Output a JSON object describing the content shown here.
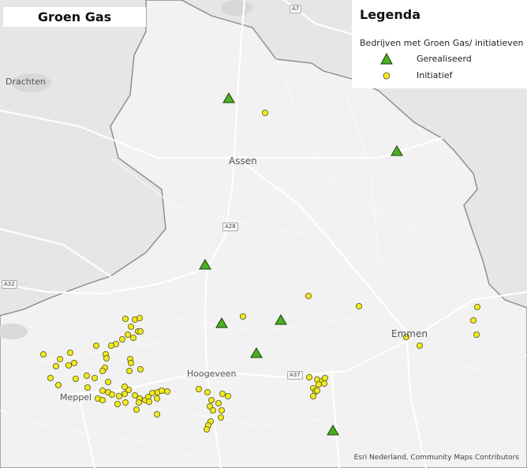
{
  "title": "Groen Gas",
  "legend": {
    "title": "Legenda",
    "subtitle": "Bedrijven met Groen Gas/ initiatieven",
    "items": [
      {
        "label": "Gerealiseerd",
        "symbol": "triangle-icon",
        "color": "#4caf20"
      },
      {
        "label": "Initiatief",
        "symbol": "circle-icon",
        "color": "#f0ea1e"
      }
    ]
  },
  "places": [
    "Drachten",
    "Assen",
    "Emmen",
    "Hoogeveen",
    "Meppel"
  ],
  "roads": [
    "A7",
    "A28",
    "A32",
    "A37"
  ],
  "attribution": "Esri Nederland, Community Maps Contributors",
  "colors": {
    "background": "#e9e9e9",
    "province_fill": "#f3f3f3",
    "province_border": "#8a8a8a",
    "realised": "#4caf20",
    "initiative": "#f0ea1e"
  }
}
